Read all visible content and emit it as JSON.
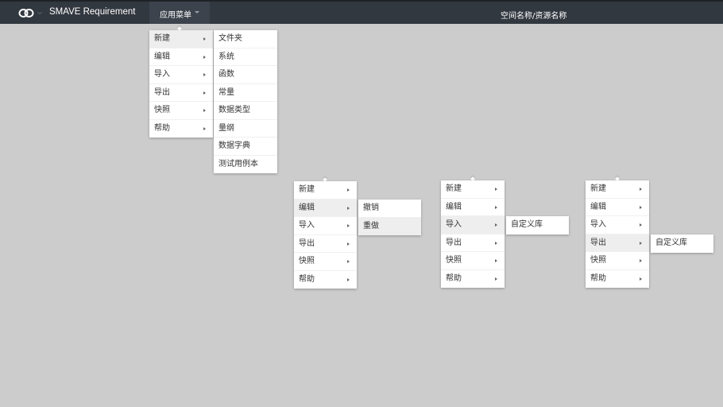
{
  "header": {
    "app_title": "SMAVE Requirement",
    "app_menu_label": "应用菜单",
    "workspace_title": "空间名称/资源名称"
  },
  "menu_items": [
    "新建",
    "编辑",
    "导入",
    "导出",
    "快照",
    "帮助"
  ],
  "submenus": {
    "new": [
      "文件夹",
      "系统",
      "函数",
      "常量",
      "数据类型",
      "量纲",
      "数据字典",
      "测试用例本"
    ],
    "edit": [
      "撤销",
      "重做"
    ],
    "import": [
      "自定义库"
    ],
    "export": [
      "自定义库"
    ]
  },
  "colors": {
    "background": "#cccccc",
    "topbar": "#323840",
    "menu_bg": "#ffffff",
    "menu_active": "#eeeeee"
  },
  "icons": {
    "logo": "link-logo-icon",
    "caret": "caret-down-icon",
    "submenu_arrow": "caret-right-icon"
  }
}
